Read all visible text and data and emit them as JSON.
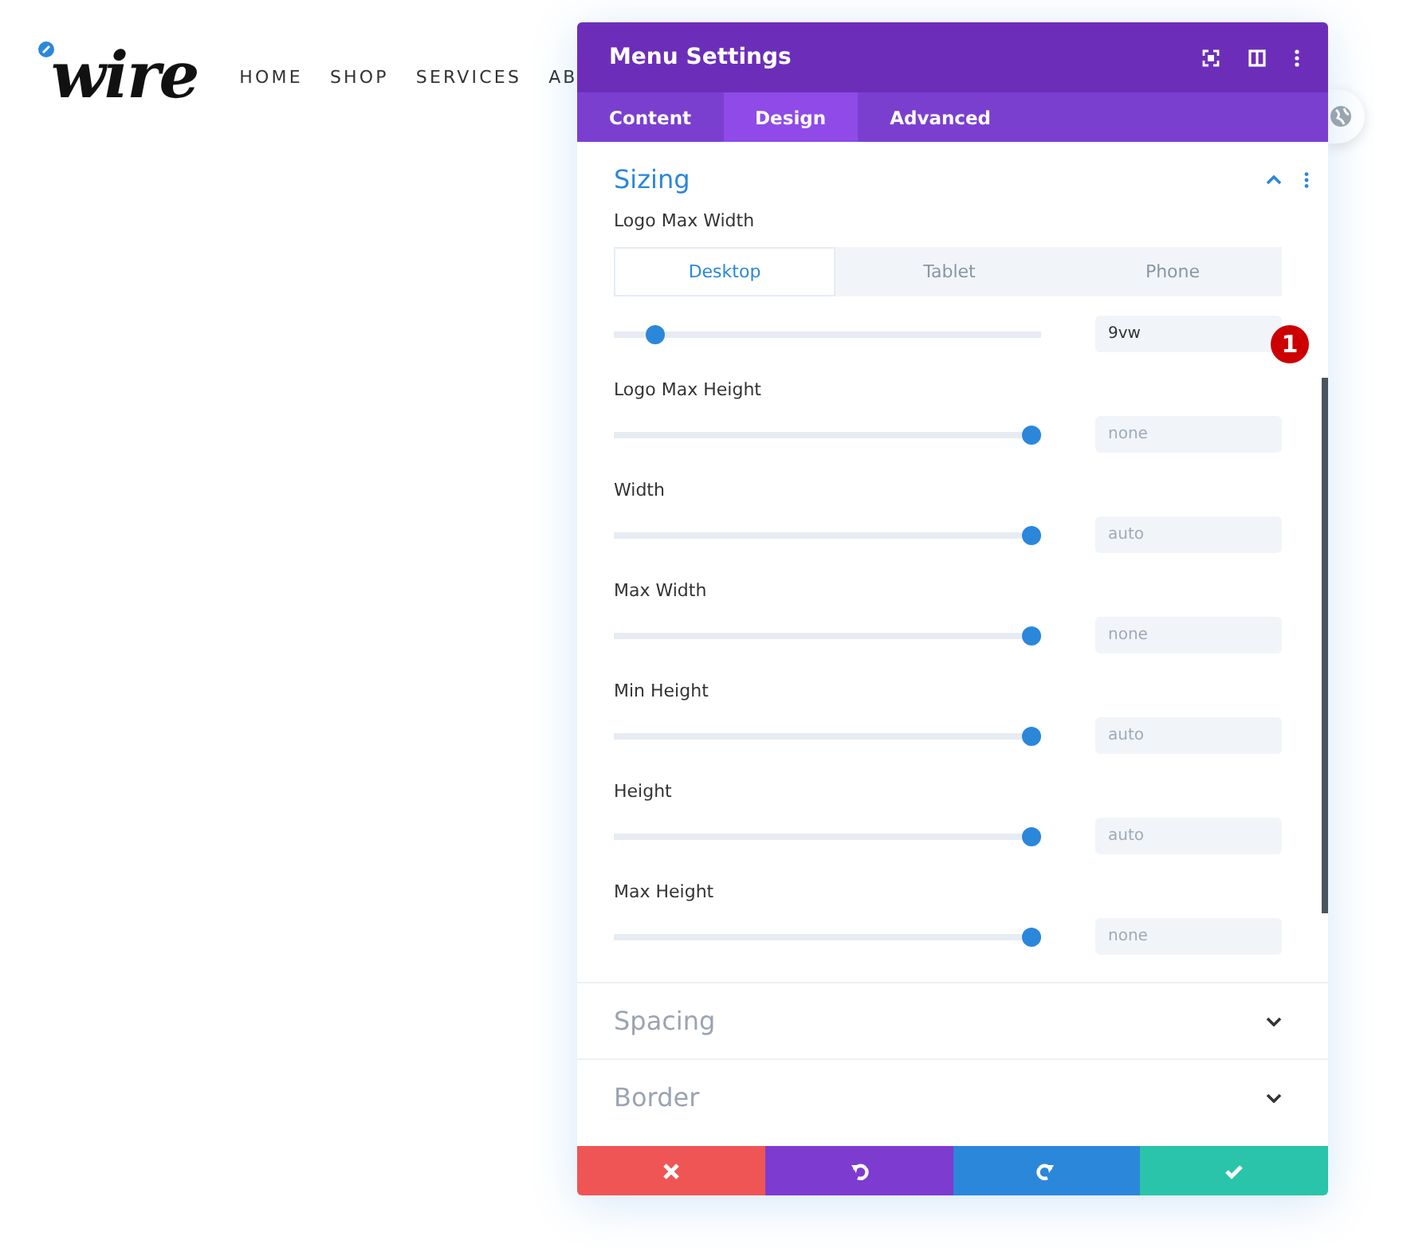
{
  "site": {
    "logo": "wire",
    "nav": [
      "HOME",
      "SHOP",
      "SERVICES",
      "AB"
    ]
  },
  "panel": {
    "title": "Menu Settings",
    "tabs": [
      {
        "label": "Content",
        "selected": false
      },
      {
        "label": "Design",
        "selected": true
      },
      {
        "label": "Advanced",
        "selected": false
      }
    ],
    "section": {
      "title": "Sizing",
      "expanded": true
    },
    "settings": [
      {
        "label": "Logo Max Width",
        "devices": [
          {
            "label": "Desktop",
            "selected": true
          },
          {
            "label": "Tablet",
            "selected": false
          },
          {
            "label": "Phone",
            "selected": false
          }
        ],
        "level": 0.1,
        "value": "9vw",
        "badge": "1"
      },
      {
        "label": "Logo Max Height",
        "level": 1,
        "placeholder": "none"
      },
      {
        "label": "Width",
        "level": 1,
        "placeholder": "auto"
      },
      {
        "label": "Max Width",
        "level": 1,
        "placeholder": "none"
      },
      {
        "label": "Min Height",
        "level": 1,
        "placeholder": "auto"
      },
      {
        "label": "Height",
        "level": 1,
        "placeholder": "auto"
      },
      {
        "label": "Max Height",
        "level": 1,
        "placeholder": "none"
      }
    ],
    "collapsed_sections": [
      {
        "title": "Spacing",
        "expanded": false
      },
      {
        "title": "Border",
        "expanded": false
      }
    ],
    "footer": [
      {
        "kind": "cancel"
      },
      {
        "kind": "undo"
      },
      {
        "kind": "redo"
      },
      {
        "kind": "save"
      }
    ]
  }
}
